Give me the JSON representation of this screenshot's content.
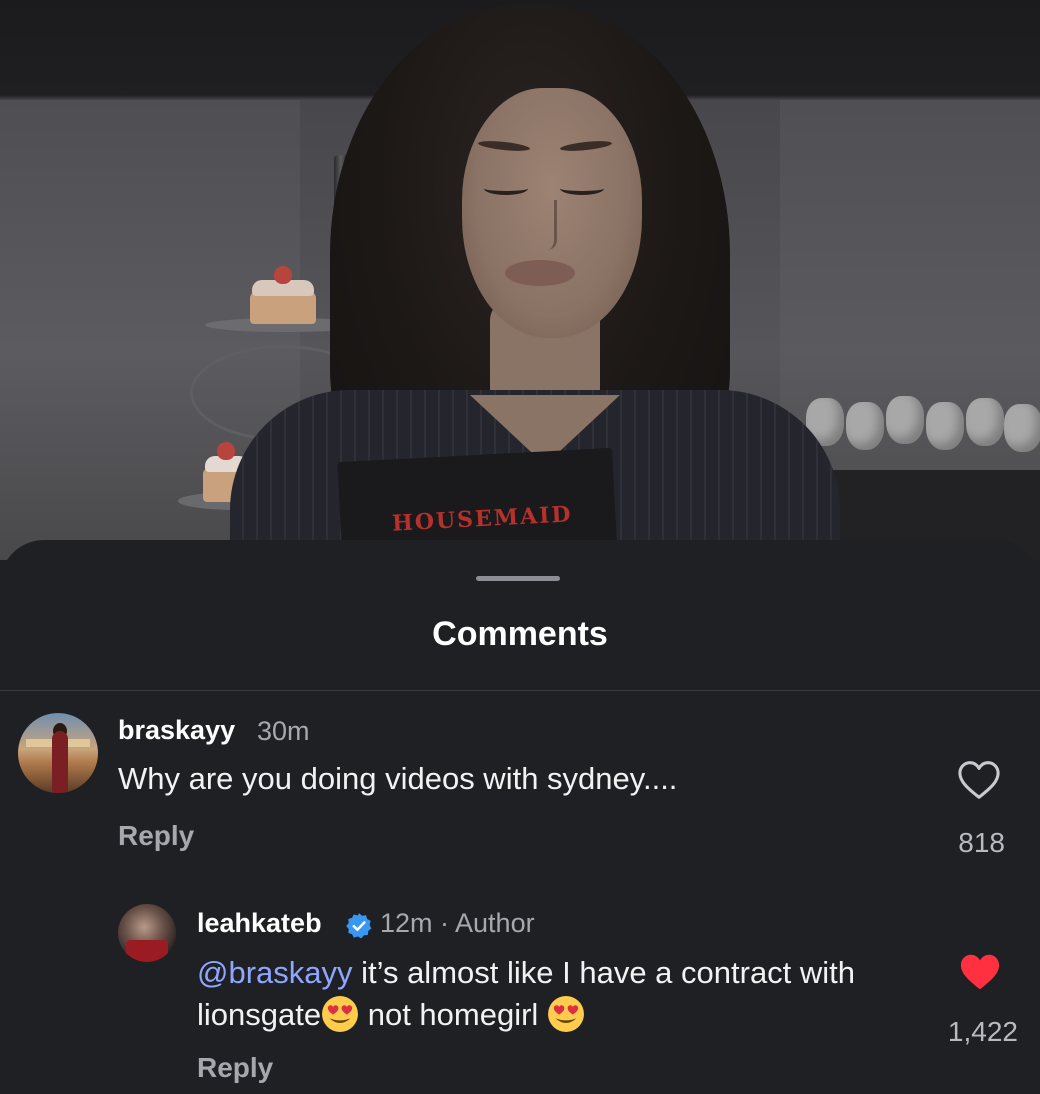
{
  "video": {
    "book_title": "HOUSEMAID"
  },
  "sheet": {
    "title": "Comments"
  },
  "comments": [
    {
      "username": "braskayy",
      "time": "30m",
      "text": "Why are you doing videos with sydney....",
      "reply_label": "Reply",
      "likes": "818",
      "liked": false,
      "icons": {
        "avatar": "avatar",
        "like": "heart-outline-icon"
      }
    },
    {
      "username": "leahkateb",
      "verified": true,
      "meta": "12m · Author",
      "mention": "@braskayy",
      "text_part1": " it’s almost like I have a contract with lionsgate",
      "text_part2": " not homegirl ",
      "reply_label": "Reply",
      "likes": "1,422",
      "liked": true,
      "like_color": "#ff3040",
      "icons": {
        "avatar": "avatar",
        "like": "heart-filled-icon",
        "verified": "verified-badge-icon",
        "emoji": "heart-eyes-emoji-icon"
      }
    }
  ],
  "colors": {
    "sheet_background": "#1f2024",
    "mention": "#8fa6ff",
    "verified": "#3897f0"
  }
}
